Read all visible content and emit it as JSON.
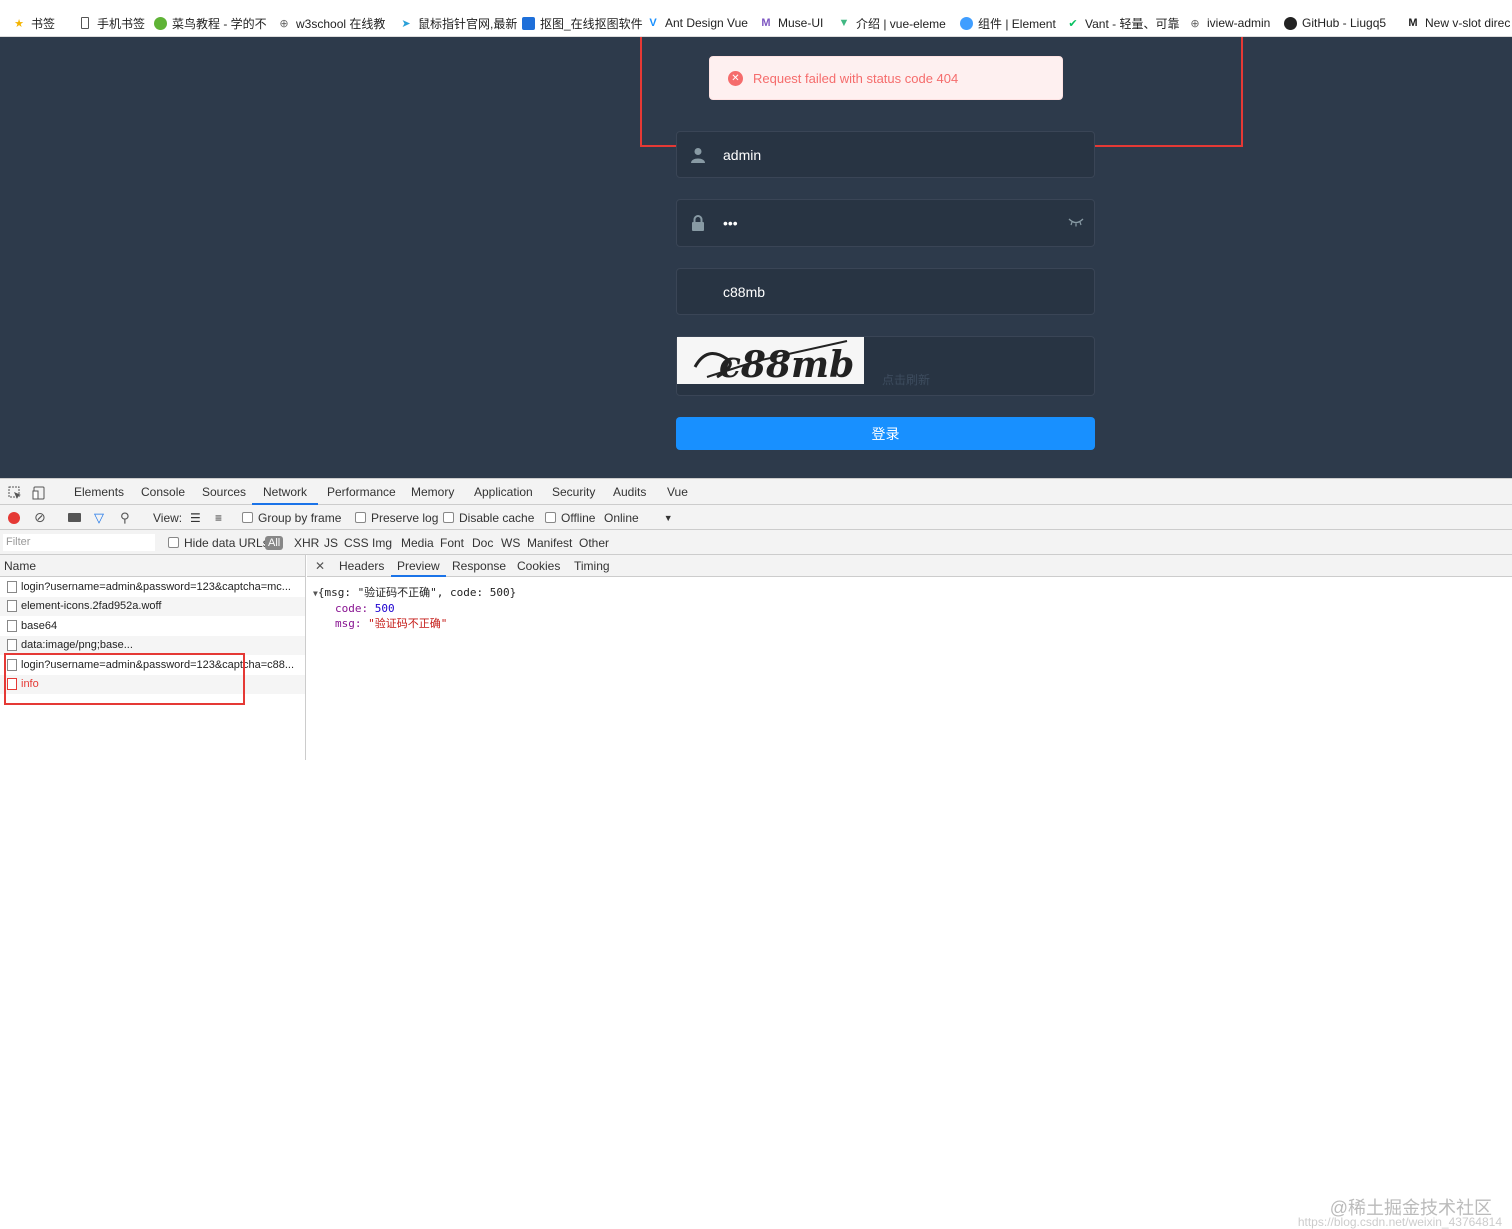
{
  "bookmarks": [
    {
      "label": "书签",
      "icon": "star-icon"
    },
    {
      "label": "手机书签",
      "icon": "phone-icon"
    },
    {
      "label": "菜鸟教程 - 学的不",
      "icon": "runoob-icon"
    },
    {
      "label": "w3school 在线教",
      "icon": "globe-icon"
    },
    {
      "label": "鼠标指针官网,最新",
      "icon": "cursor-icon"
    },
    {
      "label": "抠图_在线抠图软件",
      "icon": "app-icon"
    },
    {
      "label": "Ant Design Vue",
      "icon": "antd-icon"
    },
    {
      "label": "Muse-UI",
      "icon": "muse-icon"
    },
    {
      "label": "介绍 | vue-eleme",
      "icon": "vue-icon"
    },
    {
      "label": "组件 | Element",
      "icon": "element-icon"
    },
    {
      "label": "Vant - 轻量、可靠",
      "icon": "vant-icon"
    },
    {
      "label": "iview-admin",
      "icon": "globe-icon"
    },
    {
      "label": "GitHub - Liugq5",
      "icon": "github-icon"
    },
    {
      "label": "New v-slot direc",
      "icon": "medium-icon"
    }
  ],
  "toast": {
    "message": "Request failed with status code 404"
  },
  "login": {
    "username": "admin",
    "password": "•••",
    "captcha_value": "c88mb",
    "captcha_image_text": "c88mb",
    "captcha_hint": "点击刷新",
    "submit_label": "登录"
  },
  "devtools": {
    "tabs": [
      "Elements",
      "Console",
      "Sources",
      "Network",
      "Performance",
      "Memory",
      "Application",
      "Security",
      "Audits",
      "Vue"
    ],
    "active_tab": "Network",
    "toolbar": {
      "view_label": "View:",
      "group_by_frame": "Group by frame",
      "preserve_log": "Preserve log",
      "disable_cache": "Disable cache",
      "offline": "Offline",
      "throttle": "Online"
    },
    "filter": {
      "placeholder": "Filter",
      "hide_data_urls": "Hide data URLs",
      "all": "All",
      "types": [
        "XHR",
        "JS",
        "CSS",
        "Img",
        "Media",
        "Font",
        "Doc",
        "WS",
        "Manifest",
        "Other"
      ]
    },
    "name_header": "Name",
    "requests": [
      "login?username=admin&password=123&captcha=mc...",
      "element-icons.2fad952a.woff",
      "base64",
      "data:image/png;base...",
      "login?username=admin&password=123&captcha=c88...",
      "info"
    ],
    "detail_tabs": [
      "Headers",
      "Preview",
      "Response",
      "Cookies",
      "Timing"
    ],
    "active_detail_tab": "Preview",
    "preview": {
      "summary": "{msg: \"验证码不正确\", code: 500}",
      "code_key": "code:",
      "code_val": "500",
      "msg_key": "msg:",
      "msg_val": "\"验证码不正确\""
    }
  },
  "watermark": {
    "line1": "@稀土掘金技术社区",
    "line2": "https://blog.csdn.net/weixin_43764814"
  }
}
